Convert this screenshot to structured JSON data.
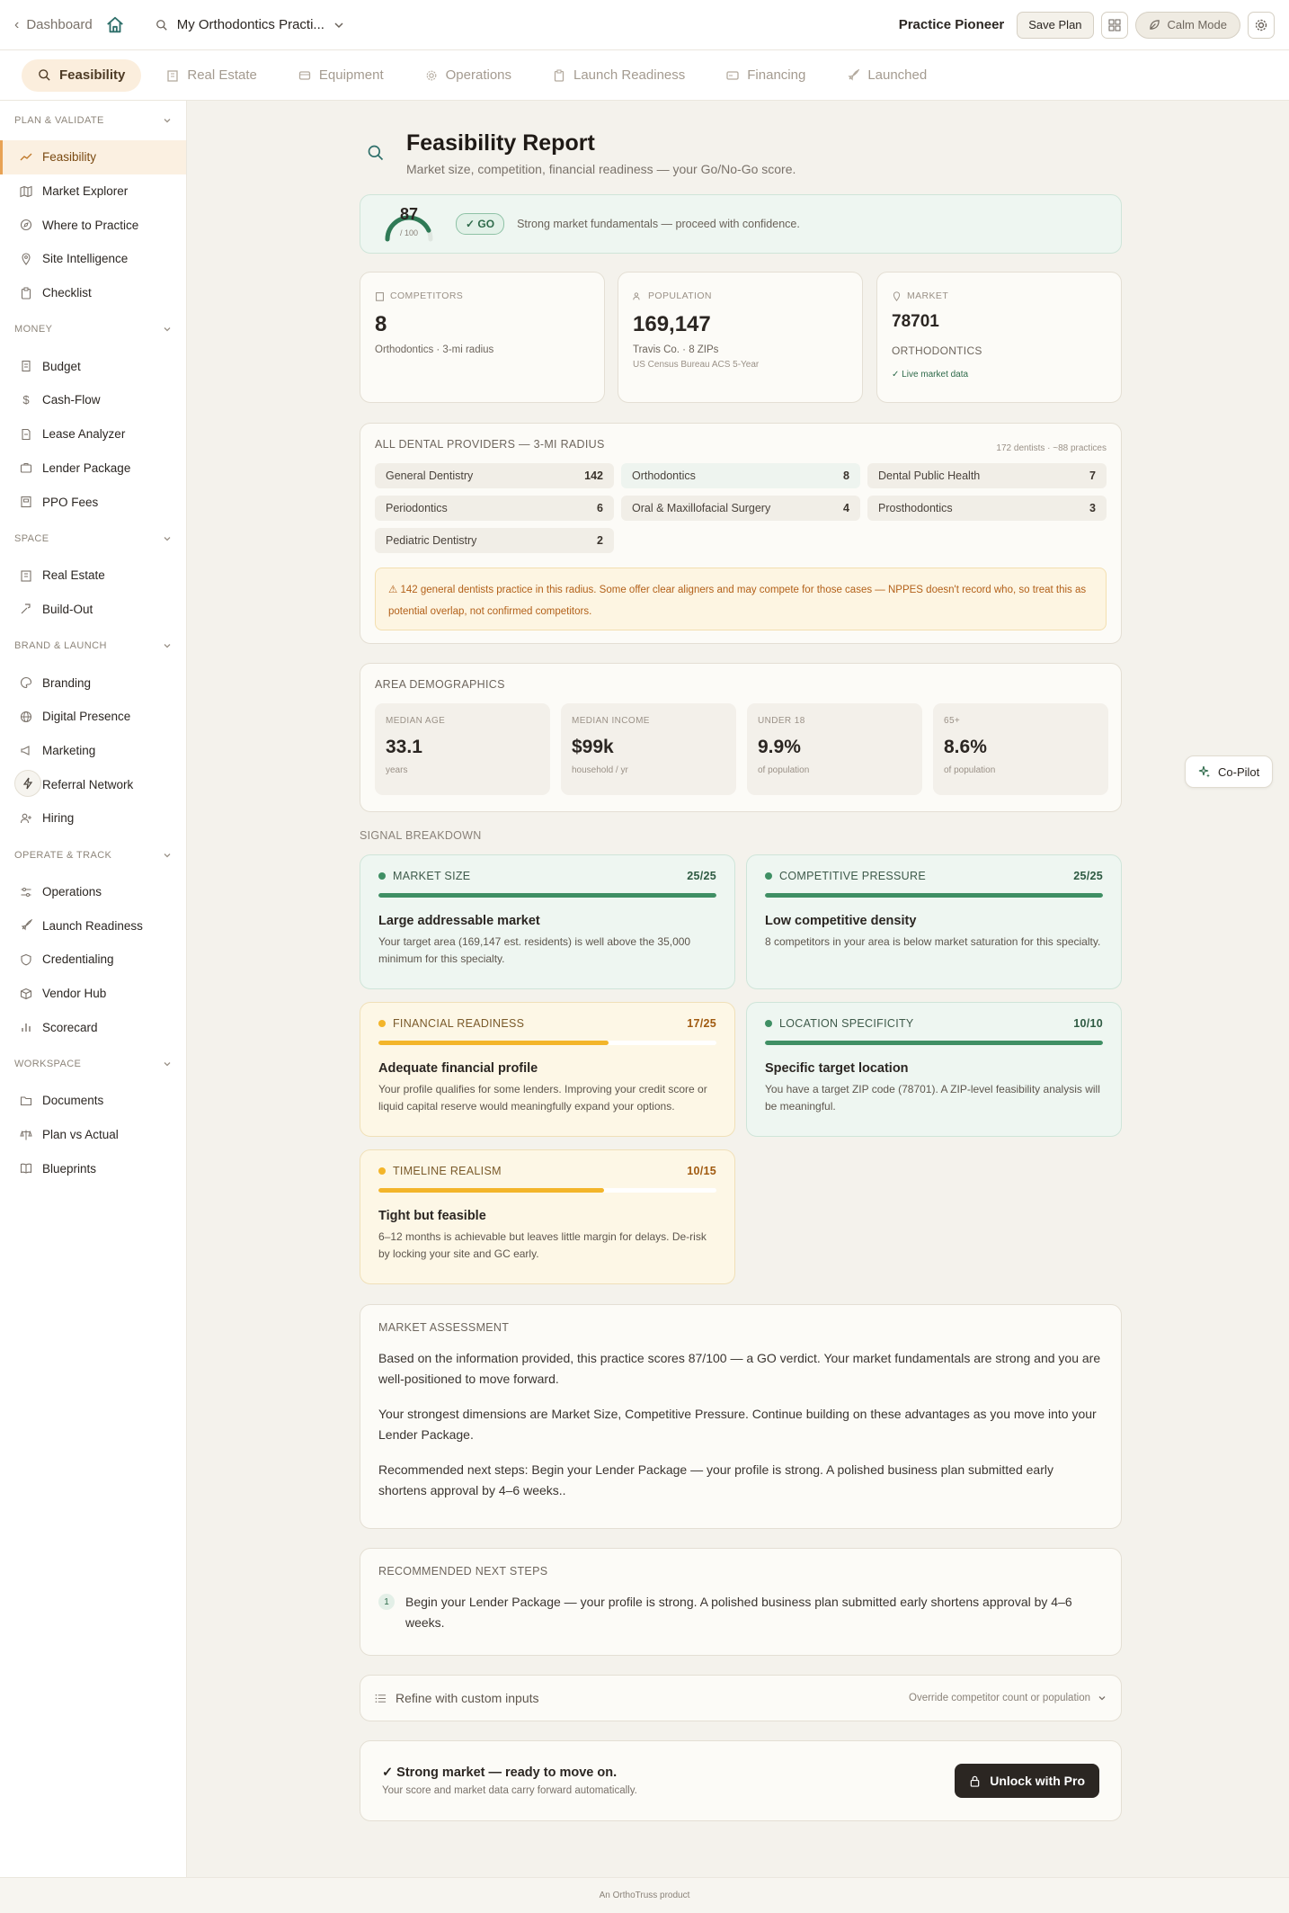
{
  "topbar": {
    "back_label": "Dashboard",
    "project_name": "My Orthodontics Practi...",
    "plan_tier": "Practice Pioneer",
    "save_label": "Save Plan",
    "calm_label": "Calm Mode"
  },
  "tabs": [
    {
      "label": "Feasibility",
      "icon": "search-icon"
    },
    {
      "label": "Real Estate",
      "icon": "building-icon"
    },
    {
      "label": "Equipment",
      "icon": "equipment-icon"
    },
    {
      "label": "Operations",
      "icon": "gear-icon"
    },
    {
      "label": "Launch Readiness",
      "icon": "clipboard-icon"
    },
    {
      "label": "Financing",
      "icon": "card-icon"
    },
    {
      "label": "Launched",
      "icon": "rocket-icon"
    }
  ],
  "sidebar": {
    "sections": [
      {
        "title": "PLAN & VALIDATE",
        "items": [
          "Feasibility",
          "Market Explorer",
          "Where to Practice",
          "Site Intelligence",
          "Checklist"
        ]
      },
      {
        "title": "MONEY",
        "items": [
          "Budget",
          "Cash-Flow",
          "Lease Analyzer",
          "Lender Package",
          "PPO Fees"
        ]
      },
      {
        "title": "SPACE",
        "items": [
          "Real Estate",
          "Build-Out"
        ]
      },
      {
        "title": "BRAND & LAUNCH",
        "items": [
          "Branding",
          "Digital Presence",
          "Marketing",
          "Referral Network",
          "Hiring"
        ]
      },
      {
        "title": "OPERATE & TRACK",
        "items": [
          "Operations",
          "Launch Readiness",
          "Credentialing",
          "Vendor Hub",
          "Scorecard"
        ]
      },
      {
        "title": "WORKSPACE",
        "items": [
          "Documents",
          "Plan vs Actual",
          "Blueprints"
        ]
      }
    ]
  },
  "header": {
    "title": "Feasibility Report",
    "subtitle": "Market size, competition, financial readiness — your Go/No-Go score."
  },
  "score": {
    "value": "87",
    "out_of": "/ 100",
    "fraction": 0.87,
    "verdict": "✓ GO",
    "message": "Strong market fundamentals — proceed with confidence."
  },
  "stats": {
    "competitors": {
      "label": "COMPETITORS",
      "value": "8",
      "sub": "Orthodontics · 3-mi radius"
    },
    "population": {
      "label": "POPULATION",
      "value": "169,147",
      "sub": "Travis Co. · 8 ZIPs",
      "source": "US Census Bureau ACS 5-Year"
    },
    "market": {
      "label": "MARKET",
      "value": "78701",
      "specialty": "ORTHODONTICS",
      "live": "✓ Live market data"
    }
  },
  "providers": {
    "title": "ALL DENTAL PROVIDERS — 3-MI RADIUS",
    "meta": "172 dentists · ~88 practices",
    "items": [
      {
        "name": "General Dentistry",
        "count": "142"
      },
      {
        "name": "Orthodontics",
        "count": "8"
      },
      {
        "name": "Dental Public Health",
        "count": "7"
      },
      {
        "name": "Periodontics",
        "count": "6"
      },
      {
        "name": "Oral & Maxillofacial Surgery",
        "count": "4"
      },
      {
        "name": "Prosthodontics",
        "count": "3"
      },
      {
        "name": "Pediatric Dentistry",
        "count": "2"
      }
    ],
    "warning": "⚠ 142 general dentists practice in this radius. Some offer clear aligners and may compete for those cases — NPPES doesn't record who, so treat this as potential overlap, not confirmed competitors."
  },
  "demographics": {
    "title": "AREA DEMOGRAPHICS",
    "items": [
      {
        "label": "MEDIAN AGE",
        "value": "33.1",
        "unit": "years"
      },
      {
        "label": "MEDIAN INCOME",
        "value": "$99k",
        "unit": "household / yr"
      },
      {
        "label": "UNDER 18",
        "value": "9.9%",
        "unit": "of population"
      },
      {
        "label": "65+",
        "value": "8.6%",
        "unit": "of population"
      }
    ]
  },
  "signals": {
    "title": "SIGNAL BREAKDOWN",
    "items": [
      {
        "label": "MARKET SIZE",
        "score": "25/25",
        "fraction": 1.0,
        "tone": "green",
        "headline": "Large addressable market",
        "text": "Your target area (169,147 est. residents) is well above the 35,000 minimum for this specialty."
      },
      {
        "label": "COMPETITIVE PRESSURE",
        "score": "25/25",
        "fraction": 1.0,
        "tone": "green",
        "headline": "Low competitive density",
        "text": "8 competitors in your area is below market saturation for this specialty."
      },
      {
        "label": "FINANCIAL READINESS",
        "score": "17/25",
        "fraction": 0.68,
        "tone": "amber",
        "headline": "Adequate financial profile",
        "text": "Your profile qualifies for some lenders. Improving your credit score or liquid capital reserve would meaningfully expand your options."
      },
      {
        "label": "LOCATION SPECIFICITY",
        "score": "10/10",
        "fraction": 1.0,
        "tone": "green",
        "headline": "Specific target location",
        "text": "You have a target ZIP code (78701). A ZIP-level feasibility analysis will be meaningful."
      },
      {
        "label": "TIMELINE REALISM",
        "score": "10/15",
        "fraction": 0.667,
        "tone": "amber",
        "headline": "Tight but feasible",
        "text": "6–12 months is achievable but leaves little margin for delays. De-risk by locking your site and GC early."
      }
    ]
  },
  "assessment": {
    "title": "MARKET ASSESSMENT",
    "paragraphs": [
      "Based on the information provided, this practice scores 87/100 — a GO verdict. Your market fundamentals are strong and you are well-positioned to move forward.",
      "Your strongest dimensions are Market Size, Competitive Pressure. Continue building on these advantages as you move into your Lender Package.",
      "Recommended next steps: Begin your Lender Package — your profile is strong. A polished business plan submitted early shortens approval by 4–6 weeks.."
    ]
  },
  "next_steps": {
    "title": "RECOMMENDED NEXT STEPS",
    "items": [
      {
        "n": "1",
        "text": "Begin your Lender Package — your profile is strong. A polished business plan submitted early shortens approval by 4–6 weeks."
      }
    ]
  },
  "refine": {
    "label": "Refine with custom inputs",
    "hint": "Override competitor count or population"
  },
  "cta": {
    "title": "✓ Strong market — ready to move on.",
    "sub": "Your score and market data carry forward automatically.",
    "button": "Unlock with Pro"
  },
  "copilot_label": "Co-Pilot",
  "footer": "An OrthoTruss product",
  "colors": {
    "accent": "#e8a254",
    "green": "#3f8f64",
    "amber": "#f3b52a",
    "dark": "#2b2622"
  }
}
